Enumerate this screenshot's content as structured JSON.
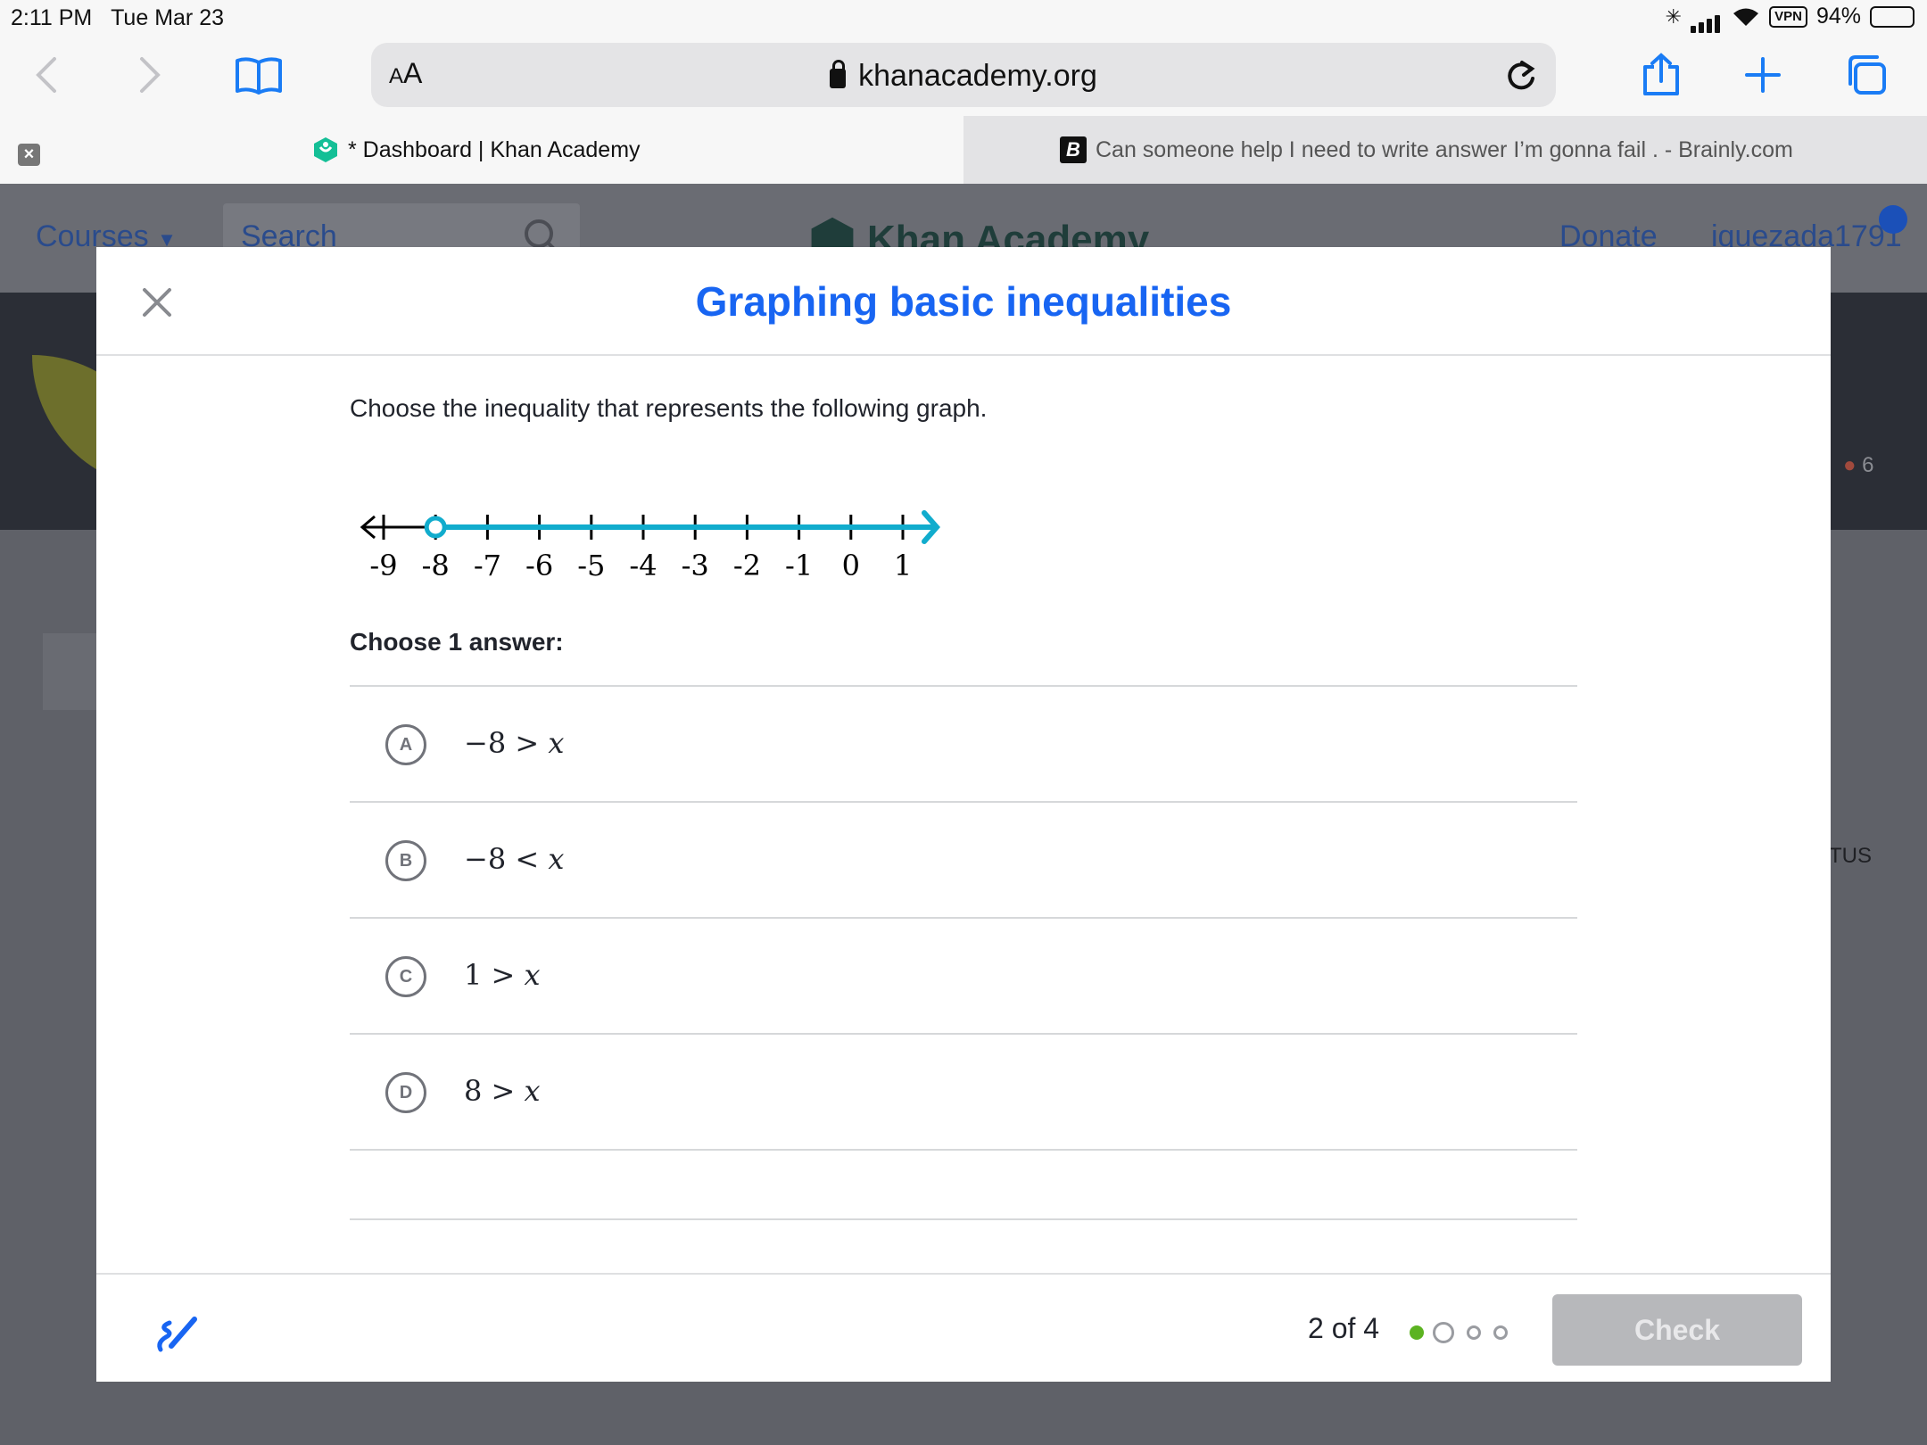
{
  "status_bar": {
    "time": "2:11 PM",
    "date": "Tue Mar 23",
    "vpn": "VPN",
    "battery": "94%",
    "battery_level": 0.94
  },
  "toolbar": {
    "reader": "A",
    "reader_big": "A",
    "url": "khanacademy.org"
  },
  "tabs": [
    {
      "title": "* Dashboard | Khan Academy",
      "active": true
    },
    {
      "icon_letter": "B",
      "title": "Can someone help I need to write answer I’m gonna fail . - Brainly.com",
      "active": false
    }
  ],
  "background_page": {
    "courses": "Courses",
    "search_placeholder": "Search",
    "logo": "Khan Academy",
    "donate": "Donate",
    "username": "iquezada1791",
    "streak": "6",
    "status_col": "TUS"
  },
  "modal": {
    "title": "Graphing basic inequalities",
    "question": "Choose the inequality that represents the following graph.",
    "answer_heading": "Choose 1 answer:",
    "number_line": {
      "ticks": [
        "-9",
        "-8",
        "-7",
        "-6",
        "-5",
        "-4",
        "-3",
        "-2",
        "-1",
        "0",
        "1"
      ],
      "open_circle_at": -8,
      "shaded_direction": "right",
      "shade_color": "#11accd"
    },
    "choices": [
      {
        "letter": "A",
        "lhs": "−8",
        "op": ">",
        "var": "x"
      },
      {
        "letter": "B",
        "lhs": "−8",
        "op": "<",
        "var": "x"
      },
      {
        "letter": "C",
        "lhs": "1",
        "op": ">",
        "var": "x"
      },
      {
        "letter": "D",
        "lhs": "8",
        "op": ">",
        "var": "x"
      }
    ],
    "footer": {
      "progress": "2 of 4",
      "progress_current": 1,
      "progress_total": 4,
      "check_label": "Check"
    }
  },
  "colors": {
    "title_blue": "#1865f2",
    "progress_green": "#5cb321",
    "check_disabled": "#b7b8bb"
  }
}
